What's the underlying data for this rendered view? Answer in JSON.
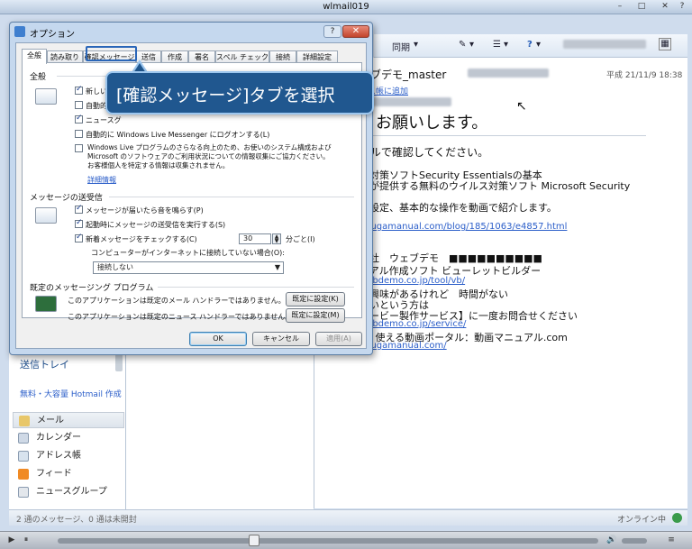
{
  "window": {
    "title": "wlmail019",
    "min": "–",
    "max": "□",
    "close": "✕",
    "help": "?"
  },
  "toolbar": {
    "sync": "同期",
    "sync_arrow": "▾",
    "pen": "✎",
    "pen_arrow": "▾",
    "view": "☰",
    "view_arrow": "▾",
    "help": "?",
    "help_arrow": "▾"
  },
  "reading": {
    "from": "ェブデモ_master",
    "date": "平成 21/11/9 18:38",
    "add_contact": "レス帳に追加",
    "headline": "くお願いします。",
    "lines": [
      "アルで確認してください。",
      "ス対策ソフトSecurity Essentialsの基本",
      "トが提供する無料のウイルス対策ソフト Microsoft Security",
      "の",
      "・設定、基本的な操作を動画で紹介します。",
      "dougamanual.com/blog/185/1063/e4857.html",
      "会社　ウェブデモ　■■■■■■■■■■",
      "ュアル作成ソフト ビューレットビルダー",
      "webdemo.co.jp/tool/vb/",
      "に興味があるけれど　時間がない",
      "ないという方は",
      "ムービー製作サービス】に一度お問合せください",
      "webdemo.co.jp/service/",
      "v　使える動画ポータル：動画マニュアル.com",
      "dougamanual.com/"
    ]
  },
  "left": {
    "sent": "送信トレイ",
    "hotmail": "無料・大容量 Hotmail 作成",
    "nav": [
      "メール",
      "カレンダー",
      "アドレス帳",
      "フィード",
      "ニュースグループ"
    ]
  },
  "status": {
    "left": "2 通のメッセージ、0 通は未開封",
    "right": "オンライン中"
  },
  "player": {
    "play": "▶",
    "pause": "⏸",
    "vol": "🔊",
    "menu": "≡"
  },
  "dialog": {
    "title": "オプション",
    "tabs": [
      "全般",
      "読み取り",
      "確認メッセージ",
      "送信",
      "作成",
      "署名",
      "スペル チェック",
      "接続",
      "詳細設定"
    ],
    "sec_general": "全般",
    "chk_new": "新しい",
    "chk_auto1": "自動的",
    "chk_news": "ニュースグ",
    "chk_auto3": "自動的に Windows Live Messenger にログオンする(L)",
    "privacy": [
      "Windows Live プログラムのさらなる向上のため、お使いのシステム構成および",
      "Microsoft のソフトウェアのご利用状況についての情報収集にご協力ください。",
      "お客様個人を特定する情報は収集されません。"
    ],
    "details": "詳細情報",
    "sec_send_recv": "メッセージの送受信",
    "chk_sound": "メッセージが届いたら音を鳴らす(P)",
    "chk_startup": "起動時にメッセージの送受信を実行する(S)",
    "chk_check": "新着メッセージをチェックする(C)",
    "interval": "30",
    "interval_unit": "分ごと(I)",
    "offline_label": "コンピューターがインターネットに接続していない場合(O):",
    "offline_value": "接続しない",
    "sec_default": "既定のメッセージング プログラム",
    "default_mail": "このアプリケーションは既定のメール ハンドラーではありません。",
    "default_news": "このアプリケーションは既定のニュース ハンドラーではありません。",
    "set_default_k": "既定に設定(K)",
    "set_default_m": "既定に設定(M)",
    "ok": "OK",
    "cancel": "キャンセル",
    "apply": "適用(A)"
  },
  "callout": "[確認メッセージ]タブを選択"
}
